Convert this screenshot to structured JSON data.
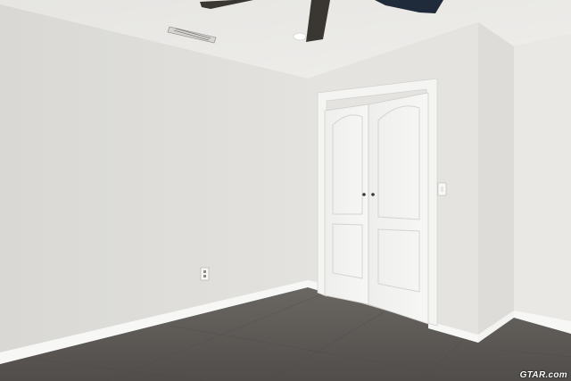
{
  "scene": {
    "description_name": "empty-bedroom-with-closet",
    "colors": {
      "ceiling": "#ecebe8",
      "left_wall": "#dcdbd7",
      "back_wall": "#e4e3df",
      "right_wall": "#e8e7e3",
      "floor": "#5e5a57",
      "trim": "#f7f7f5",
      "door": "#f3f3f1",
      "fan_blade": "#3a3733"
    }
  },
  "watermark": {
    "text": "GTAR.com"
  }
}
